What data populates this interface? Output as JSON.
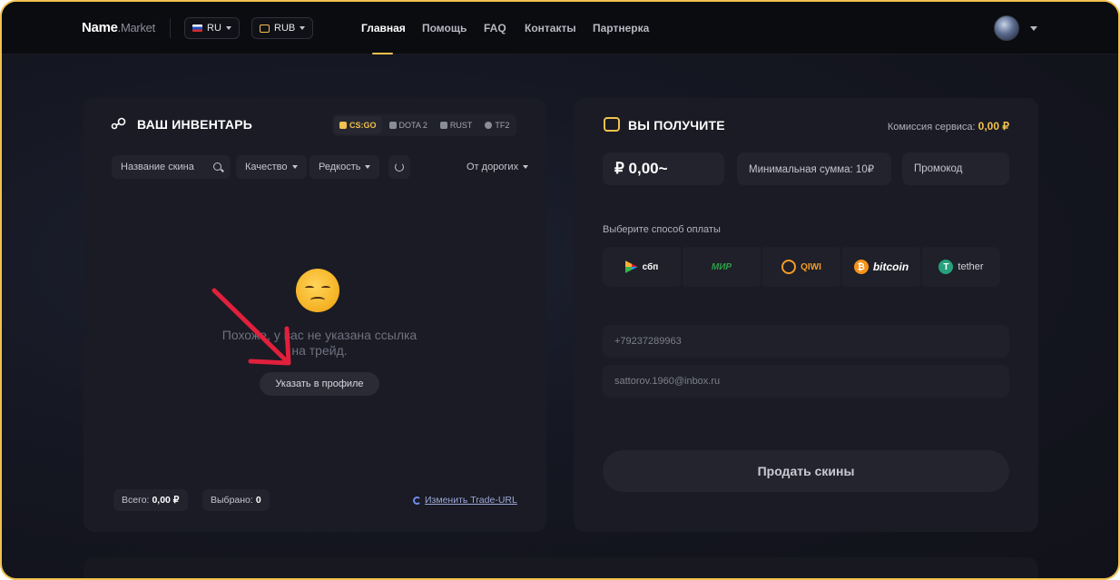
{
  "header": {
    "logo_name": "Name",
    "logo_suffix": ".Market",
    "language": "RU",
    "currency": "RUB",
    "nav": [
      "Главная",
      "Помощь",
      "FAQ",
      "Контакты",
      "Партнерка"
    ],
    "active_nav": "Главная"
  },
  "inventory": {
    "title": "ВАШ ИНВЕНТАРЬ",
    "games": [
      "CS:GO",
      "DOTA 2",
      "RUST",
      "TF2"
    ],
    "active_game": "CS:GO",
    "search_placeholder": "Название скина",
    "filters": {
      "quality": "Качество",
      "rarity": "Редкость",
      "sort": "От дорогих"
    },
    "empty_emoji": "disappointed-face",
    "empty_line1": "Похоже, у вас не указана ссылка",
    "empty_line2": "на трейд.",
    "profile_button": "Указать в профиле",
    "total_label": "Всего:",
    "total_value": "0,00 ₽",
    "selected_label": "Выбрано:",
    "selected_value": "0",
    "trade_url_link": "Изменить Trade-URL"
  },
  "payout": {
    "title": "ВЫ ПОЛУЧИТЕ",
    "commission_label": "Комиссия сервиса:",
    "commission_value": "0,00 ₽",
    "amount": "₽ 0,00~",
    "min_amount": "Минимальная сумма: 10₽",
    "promo_placeholder": "Промокод",
    "pay_method_label": "Выберите способ оплаты",
    "methods": [
      {
        "name": "сбп",
        "color": "#ffffff"
      },
      {
        "name": "МИР",
        "color": "#2e9e4a"
      },
      {
        "name": "QIWI",
        "color": "#f59b25"
      },
      {
        "name": "bitcoin",
        "color": "#ffffff"
      },
      {
        "name": "tether",
        "color": "#d0d2da"
      }
    ],
    "phone": "+79237289963",
    "email": "sattorov.1960@inbox.ru",
    "sell_button": "Продать скины"
  },
  "colors": {
    "accent": "#f2c14e",
    "annotation_arrow": "#e0203c"
  }
}
